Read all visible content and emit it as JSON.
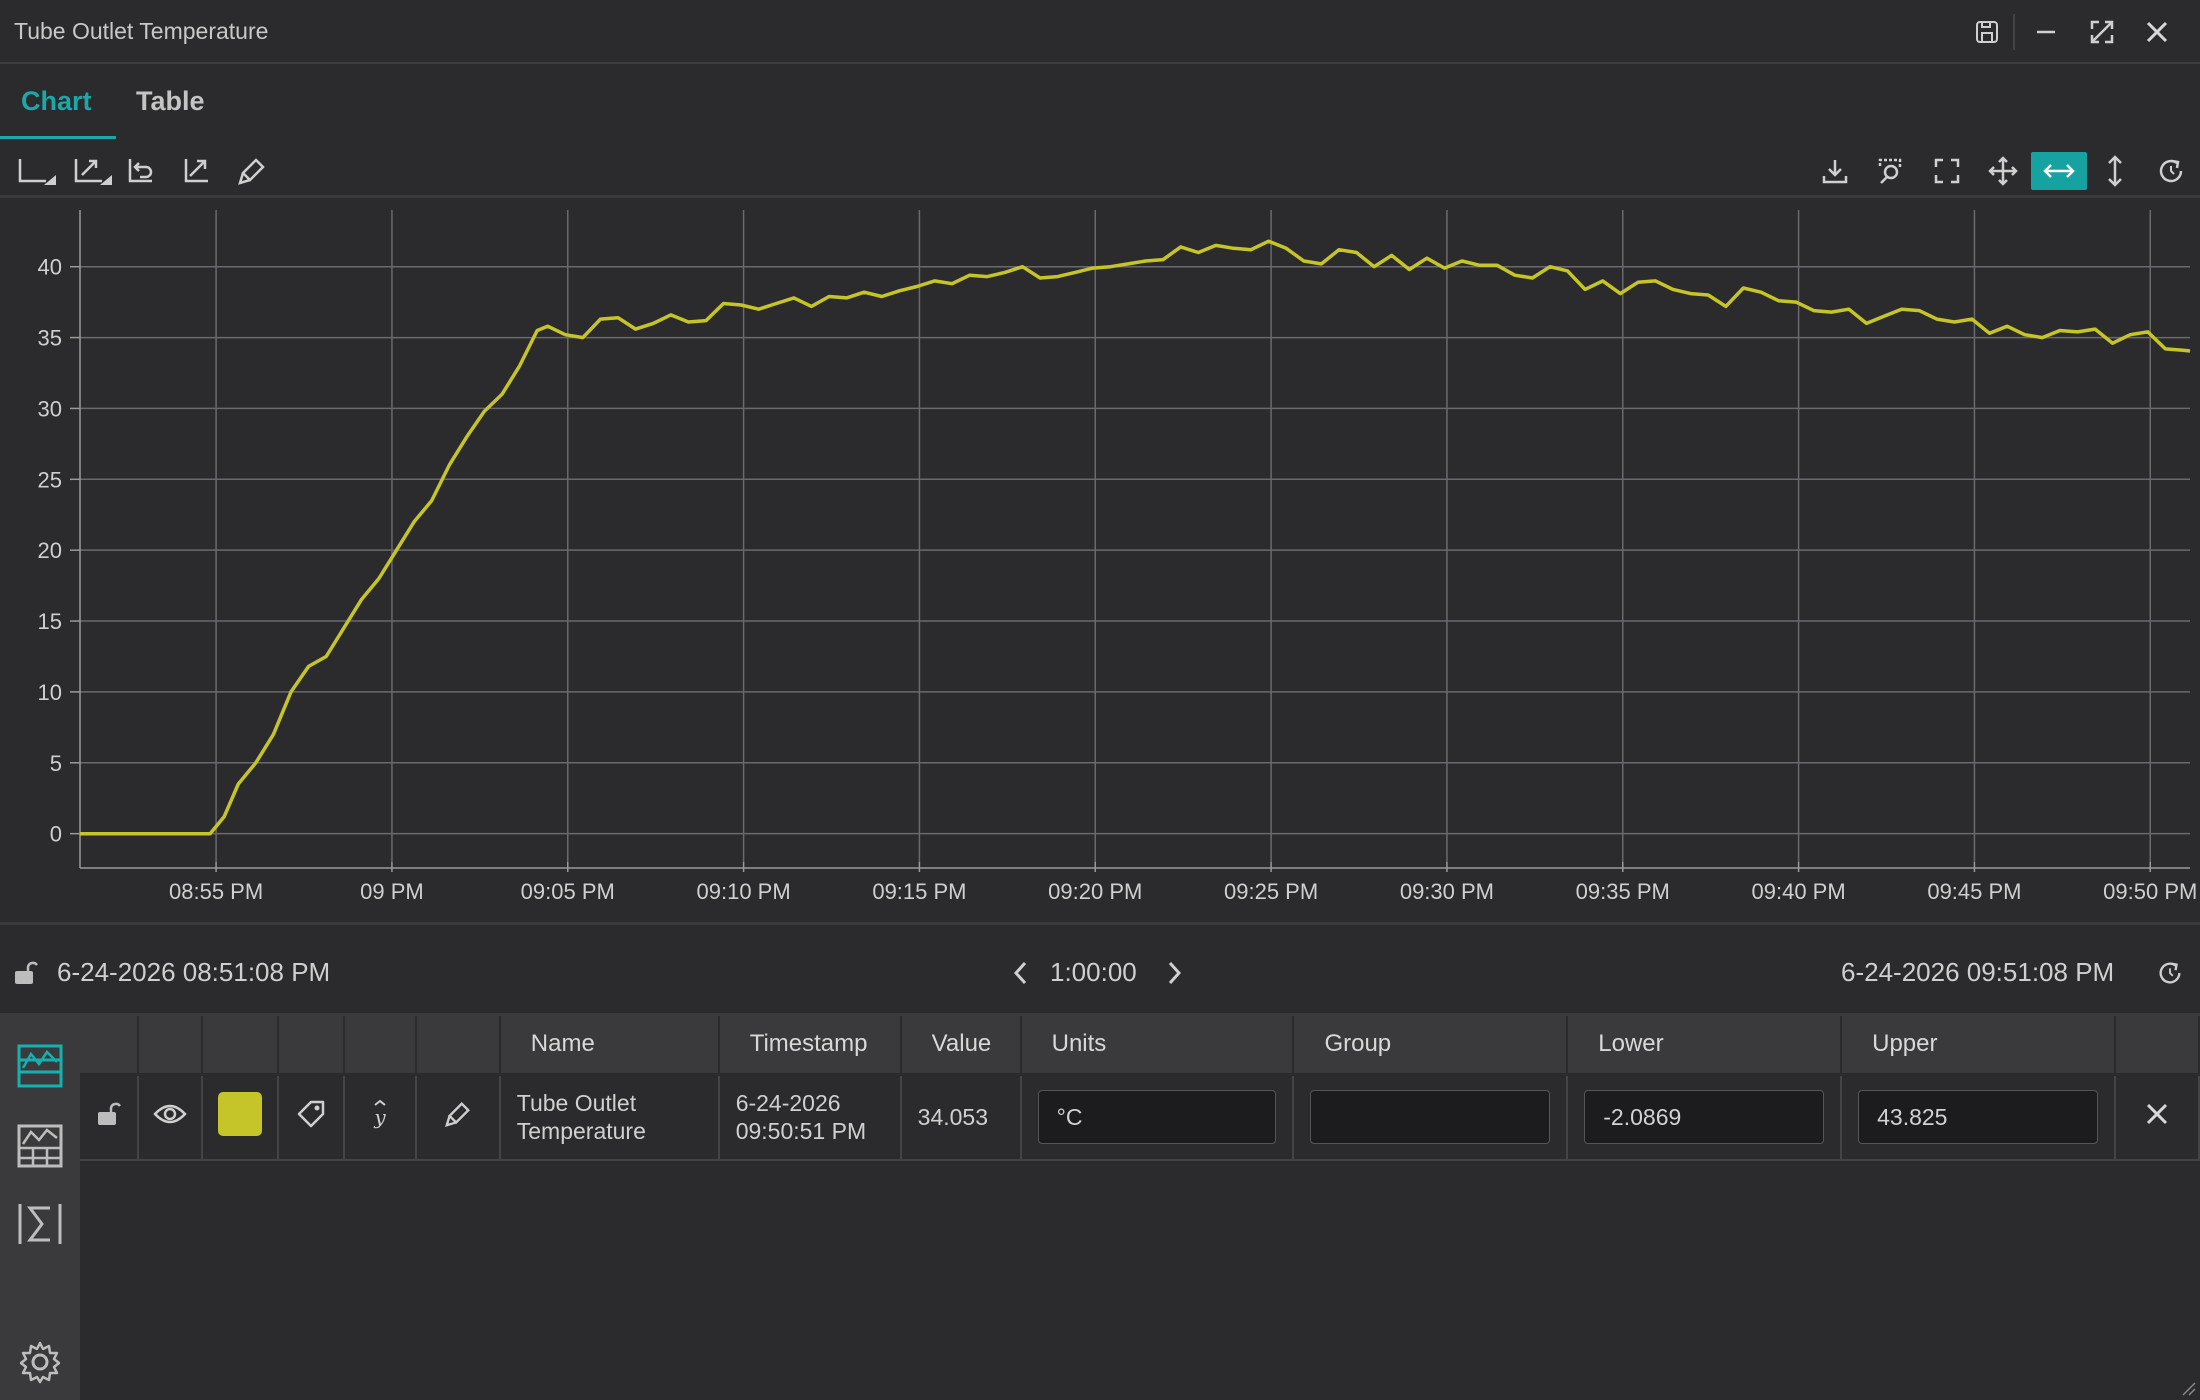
{
  "window": {
    "title": "Tube Outlet Temperature"
  },
  "tabs": [
    {
      "label": "Chart"
    },
    {
      "label": "Table"
    }
  ],
  "colors": {
    "accent": "#1aa8a8",
    "series": "#c5c52a"
  },
  "icons": {
    "titlebar": [
      "save-icon",
      "minimize-icon",
      "maximize-icon",
      "close-icon"
    ],
    "toolbar_left": [
      "axis-icon",
      "autoscale-icon",
      "undo-zoom-icon",
      "trend-icon",
      "brush-icon"
    ],
    "toolbar_right": [
      "download-icon",
      "zoom-select-icon",
      "fullscreen-icon",
      "pan-icon",
      "horizontal-pan-icon",
      "vertical-pan-icon",
      "refresh-icon"
    ]
  },
  "range": {
    "start": "6-24-2026 08:51:08 PM",
    "duration": "1:00:00",
    "end": "6-24-2026 09:51:08 PM"
  },
  "table": {
    "headers": [
      "Name",
      "Timestamp",
      "Value",
      "Units",
      "Group",
      "Lower",
      "Upper"
    ],
    "row": {
      "name_line1": "Tube Outlet",
      "name_line2": "Temperature",
      "timestamp_line1": "6-24-2026",
      "timestamp_line2": "09:50:51 PM",
      "value": "34.053",
      "units": "°C",
      "group": "",
      "lower": "-2.0869",
      "upper": "43.825"
    }
  },
  "chart_data": {
    "type": "line",
    "xlabel": "",
    "ylabel": "",
    "title": "",
    "ylim": [
      -2,
      44
    ],
    "yticks": [
      0,
      5,
      10,
      15,
      20,
      25,
      30,
      35,
      40
    ],
    "xticks": [
      "08:55 PM",
      "09 PM",
      "09:05 PM",
      "09:10 PM",
      "09:15 PM",
      "09:20 PM",
      "09:25 PM",
      "09:30 PM",
      "09:35 PM",
      "09:40 PM",
      "09:45 PM",
      "09:50 PM"
    ],
    "xtick_minutes": [
      3.87,
      8.87,
      13.87,
      18.87,
      23.87,
      28.87,
      33.87,
      38.87,
      43.87,
      48.87,
      53.87,
      58.87
    ],
    "grid": true,
    "series": [
      {
        "color": "#c5c52a",
        "x": [
          0,
          1,
          2,
          3,
          3.7,
          4.1,
          4.5,
          5.0,
          5.5,
          6.0,
          6.5,
          7.0,
          7.5,
          8.0,
          8.5,
          9.0,
          9.5,
          10.0,
          10.5,
          11.0,
          11.5,
          12.0,
          12.5,
          13.0,
          13.3,
          13.8,
          14.3,
          14.8,
          15.3,
          15.8,
          16.3,
          16.8,
          17.3,
          17.8,
          18.3,
          18.8,
          19.3,
          19.8,
          20.3,
          20.8,
          21.3,
          21.8,
          22.3,
          22.8,
          23.3,
          23.8,
          24.3,
          24.8,
          25.3,
          25.8,
          26.3,
          26.8,
          27.3,
          27.8,
          28.3,
          28.8,
          29.3,
          29.8,
          30.3,
          30.8,
          31.3,
          31.8,
          32.3,
          32.8,
          33.3,
          33.8,
          34.3,
          34.8,
          35.3,
          35.8,
          36.3,
          36.8,
          37.3,
          37.8,
          38.3,
          38.8,
          39.3,
          39.8,
          40.3,
          40.8,
          41.3,
          41.8,
          42.3,
          42.8,
          43.3,
          43.8,
          44.3,
          44.8,
          45.3,
          45.8,
          46.3,
          46.8,
          47.3,
          47.8,
          48.3,
          48.8,
          49.3,
          49.8,
          50.3,
          50.8,
          51.3,
          51.8,
          52.3,
          52.8,
          53.3,
          53.8,
          54.3,
          54.8,
          55.3,
          55.8,
          56.3,
          56.8,
          57.3,
          57.8,
          58.3,
          58.8,
          59.3,
          59.8,
          60
        ],
        "y": [
          0,
          0,
          0,
          0,
          0,
          1.2,
          3.5,
          5.0,
          7.0,
          10.0,
          11.8,
          12.5,
          14.5,
          16.5,
          18.0,
          20.0,
          22.0,
          23.5,
          26.0,
          28.0,
          29.8,
          31.0,
          33.0,
          35.5,
          35.8,
          35.2,
          35.0,
          36.3,
          36.4,
          35.6,
          36.0,
          36.6,
          36.1,
          36.2,
          37.4,
          37.3,
          37.0,
          37.4,
          37.8,
          37.2,
          37.9,
          37.8,
          38.2,
          37.9,
          38.3,
          38.6,
          39.0,
          38.8,
          39.4,
          39.3,
          39.6,
          40.0,
          39.2,
          39.3,
          39.6,
          39.9,
          40.0,
          40.2,
          40.4,
          40.5,
          41.4,
          41.0,
          41.5,
          41.3,
          41.2,
          41.8,
          41.3,
          40.4,
          40.2,
          41.2,
          41.0,
          40.0,
          40.8,
          39.8,
          40.6,
          39.9,
          40.4,
          40.1,
          40.1,
          39.4,
          39.2,
          40.0,
          39.7,
          38.4,
          39.0,
          38.1,
          38.9,
          39.0,
          38.4,
          38.1,
          38.0,
          37.2,
          38.5,
          38.2,
          37.6,
          37.5,
          36.9,
          36.8,
          37.0,
          36.0,
          36.5,
          37.0,
          36.9,
          36.3,
          36.1,
          36.3,
          35.3,
          35.8,
          35.2,
          35.0,
          35.5,
          35.4,
          35.6,
          34.6,
          35.2,
          35.4,
          34.2,
          34.1,
          34.05
        ]
      }
    ]
  }
}
